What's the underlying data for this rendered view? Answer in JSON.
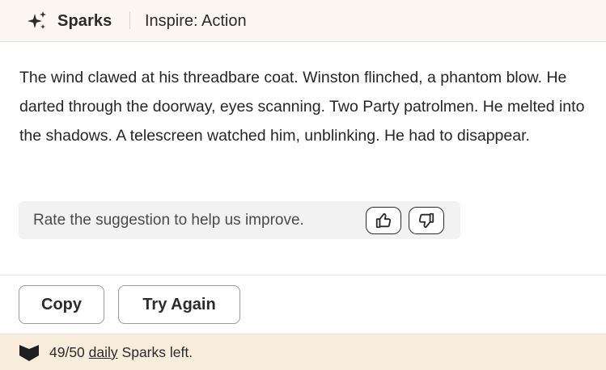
{
  "header": {
    "brand": "Sparks",
    "mode_label": "Inspire: Action"
  },
  "suggestion": {
    "text": "The wind clawed at his threadbare coat. Winston flinched, a phantom blow. He darted through the doorway, eyes scanning. Two Party patrolmen. He melted into the shadows. A telescreen watched him, unblinking. He had to disappear."
  },
  "rating": {
    "prompt": "Rate the suggestion to help us improve.",
    "up_icon": "thumbs-up-icon",
    "down_icon": "thumbs-down-icon"
  },
  "actions": {
    "copy_label": "Copy",
    "try_again_label": "Try Again"
  },
  "footer": {
    "count": "49/50",
    "daily_link": "daily",
    "suffix": "Sparks left."
  },
  "colors": {
    "header_bg": "#fbf6f2",
    "footer_bg": "#f8ecdc",
    "rate_bg": "#f2f2f2",
    "text": "#2b2b2b"
  }
}
